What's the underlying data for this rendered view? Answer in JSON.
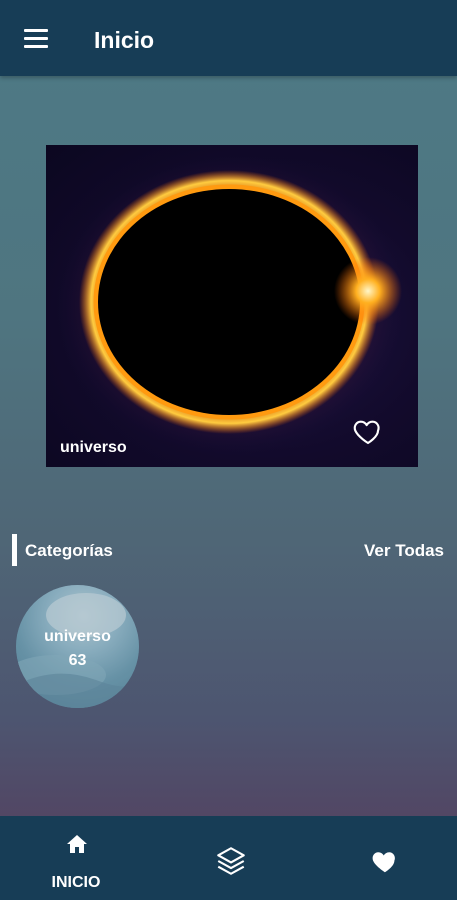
{
  "appbar": {
    "title": "Inicio",
    "menu_icon": "hamburger-menu-icon"
  },
  "featured": {
    "caption": "universo",
    "image": "solar-eclipse-ring",
    "favorite_icon": "heart-outline-icon"
  },
  "categories_section": {
    "title": "Categorías",
    "see_all": "Ver Todas",
    "items": [
      {
        "name": "universo",
        "count": "63"
      }
    ]
  },
  "bottom_nav": {
    "items": [
      {
        "label": "INICIO",
        "icon": "home-icon",
        "active": true
      },
      {
        "label": "",
        "icon": "layers-icon",
        "active": false
      },
      {
        "label": "",
        "icon": "heart-icon",
        "active": false
      }
    ]
  },
  "colors": {
    "appbar": "#173d56",
    "text": "#ffffff"
  }
}
